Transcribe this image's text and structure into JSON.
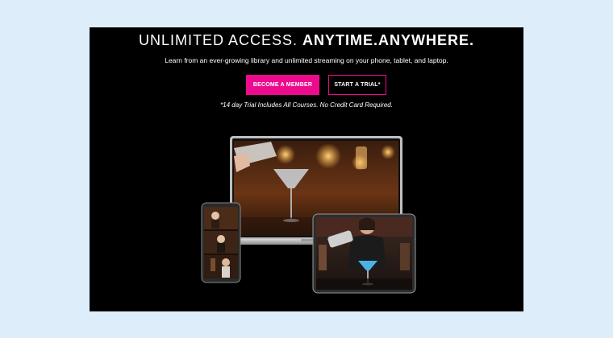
{
  "hero": {
    "headline_light": "UNLIMITED ACCESS.",
    "headline_bold": "ANYTIME.ANYWHERE.",
    "subheading": "Learn from an ever-growing library and unlimited streaming on your phone, tablet, and laptop.",
    "primary_cta": "BECOME A MEMBER",
    "secondary_cta": "START A TRIAL*",
    "footnote": "*14 day Trial Includes All Courses. No Credit Card Required."
  },
  "colors": {
    "background": "#000000",
    "page_background": "#ddeefa",
    "accent": "#ec0b8c",
    "text": "#ffffff"
  },
  "devices_image": {
    "items": [
      "laptop",
      "smartphone",
      "tablet"
    ],
    "subject": "bartender cocktail video"
  }
}
